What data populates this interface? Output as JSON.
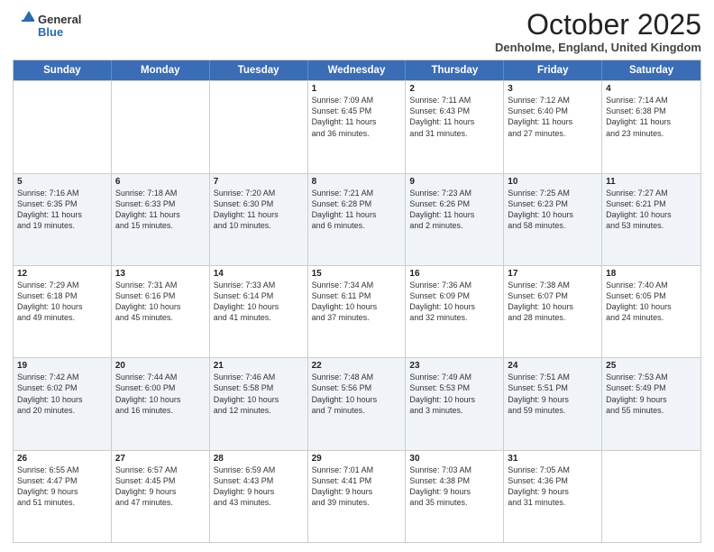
{
  "logo": {
    "general": "General",
    "blue": "Blue"
  },
  "header": {
    "month": "October 2025",
    "location": "Denholme, England, United Kingdom"
  },
  "weekdays": [
    "Sunday",
    "Monday",
    "Tuesday",
    "Wednesday",
    "Thursday",
    "Friday",
    "Saturday"
  ],
  "rows": [
    [
      {
        "day": "",
        "info": ""
      },
      {
        "day": "",
        "info": ""
      },
      {
        "day": "",
        "info": ""
      },
      {
        "day": "1",
        "info": "Sunrise: 7:09 AM\nSunset: 6:45 PM\nDaylight: 11 hours\nand 36 minutes."
      },
      {
        "day": "2",
        "info": "Sunrise: 7:11 AM\nSunset: 6:43 PM\nDaylight: 11 hours\nand 31 minutes."
      },
      {
        "day": "3",
        "info": "Sunrise: 7:12 AM\nSunset: 6:40 PM\nDaylight: 11 hours\nand 27 minutes."
      },
      {
        "day": "4",
        "info": "Sunrise: 7:14 AM\nSunset: 6:38 PM\nDaylight: 11 hours\nand 23 minutes."
      }
    ],
    [
      {
        "day": "5",
        "info": "Sunrise: 7:16 AM\nSunset: 6:35 PM\nDaylight: 11 hours\nand 19 minutes."
      },
      {
        "day": "6",
        "info": "Sunrise: 7:18 AM\nSunset: 6:33 PM\nDaylight: 11 hours\nand 15 minutes."
      },
      {
        "day": "7",
        "info": "Sunrise: 7:20 AM\nSunset: 6:30 PM\nDaylight: 11 hours\nand 10 minutes."
      },
      {
        "day": "8",
        "info": "Sunrise: 7:21 AM\nSunset: 6:28 PM\nDaylight: 11 hours\nand 6 minutes."
      },
      {
        "day": "9",
        "info": "Sunrise: 7:23 AM\nSunset: 6:26 PM\nDaylight: 11 hours\nand 2 minutes."
      },
      {
        "day": "10",
        "info": "Sunrise: 7:25 AM\nSunset: 6:23 PM\nDaylight: 10 hours\nand 58 minutes."
      },
      {
        "day": "11",
        "info": "Sunrise: 7:27 AM\nSunset: 6:21 PM\nDaylight: 10 hours\nand 53 minutes."
      }
    ],
    [
      {
        "day": "12",
        "info": "Sunrise: 7:29 AM\nSunset: 6:18 PM\nDaylight: 10 hours\nand 49 minutes."
      },
      {
        "day": "13",
        "info": "Sunrise: 7:31 AM\nSunset: 6:16 PM\nDaylight: 10 hours\nand 45 minutes."
      },
      {
        "day": "14",
        "info": "Sunrise: 7:33 AM\nSunset: 6:14 PM\nDaylight: 10 hours\nand 41 minutes."
      },
      {
        "day": "15",
        "info": "Sunrise: 7:34 AM\nSunset: 6:11 PM\nDaylight: 10 hours\nand 37 minutes."
      },
      {
        "day": "16",
        "info": "Sunrise: 7:36 AM\nSunset: 6:09 PM\nDaylight: 10 hours\nand 32 minutes."
      },
      {
        "day": "17",
        "info": "Sunrise: 7:38 AM\nSunset: 6:07 PM\nDaylight: 10 hours\nand 28 minutes."
      },
      {
        "day": "18",
        "info": "Sunrise: 7:40 AM\nSunset: 6:05 PM\nDaylight: 10 hours\nand 24 minutes."
      }
    ],
    [
      {
        "day": "19",
        "info": "Sunrise: 7:42 AM\nSunset: 6:02 PM\nDaylight: 10 hours\nand 20 minutes."
      },
      {
        "day": "20",
        "info": "Sunrise: 7:44 AM\nSunset: 6:00 PM\nDaylight: 10 hours\nand 16 minutes."
      },
      {
        "day": "21",
        "info": "Sunrise: 7:46 AM\nSunset: 5:58 PM\nDaylight: 10 hours\nand 12 minutes."
      },
      {
        "day": "22",
        "info": "Sunrise: 7:48 AM\nSunset: 5:56 PM\nDaylight: 10 hours\nand 7 minutes."
      },
      {
        "day": "23",
        "info": "Sunrise: 7:49 AM\nSunset: 5:53 PM\nDaylight: 10 hours\nand 3 minutes."
      },
      {
        "day": "24",
        "info": "Sunrise: 7:51 AM\nSunset: 5:51 PM\nDaylight: 9 hours\nand 59 minutes."
      },
      {
        "day": "25",
        "info": "Sunrise: 7:53 AM\nSunset: 5:49 PM\nDaylight: 9 hours\nand 55 minutes."
      }
    ],
    [
      {
        "day": "26",
        "info": "Sunrise: 6:55 AM\nSunset: 4:47 PM\nDaylight: 9 hours\nand 51 minutes."
      },
      {
        "day": "27",
        "info": "Sunrise: 6:57 AM\nSunset: 4:45 PM\nDaylight: 9 hours\nand 47 minutes."
      },
      {
        "day": "28",
        "info": "Sunrise: 6:59 AM\nSunset: 4:43 PM\nDaylight: 9 hours\nand 43 minutes."
      },
      {
        "day": "29",
        "info": "Sunrise: 7:01 AM\nSunset: 4:41 PM\nDaylight: 9 hours\nand 39 minutes."
      },
      {
        "day": "30",
        "info": "Sunrise: 7:03 AM\nSunset: 4:38 PM\nDaylight: 9 hours\nand 35 minutes."
      },
      {
        "day": "31",
        "info": "Sunrise: 7:05 AM\nSunset: 4:36 PM\nDaylight: 9 hours\nand 31 minutes."
      },
      {
        "day": "",
        "info": ""
      }
    ]
  ]
}
